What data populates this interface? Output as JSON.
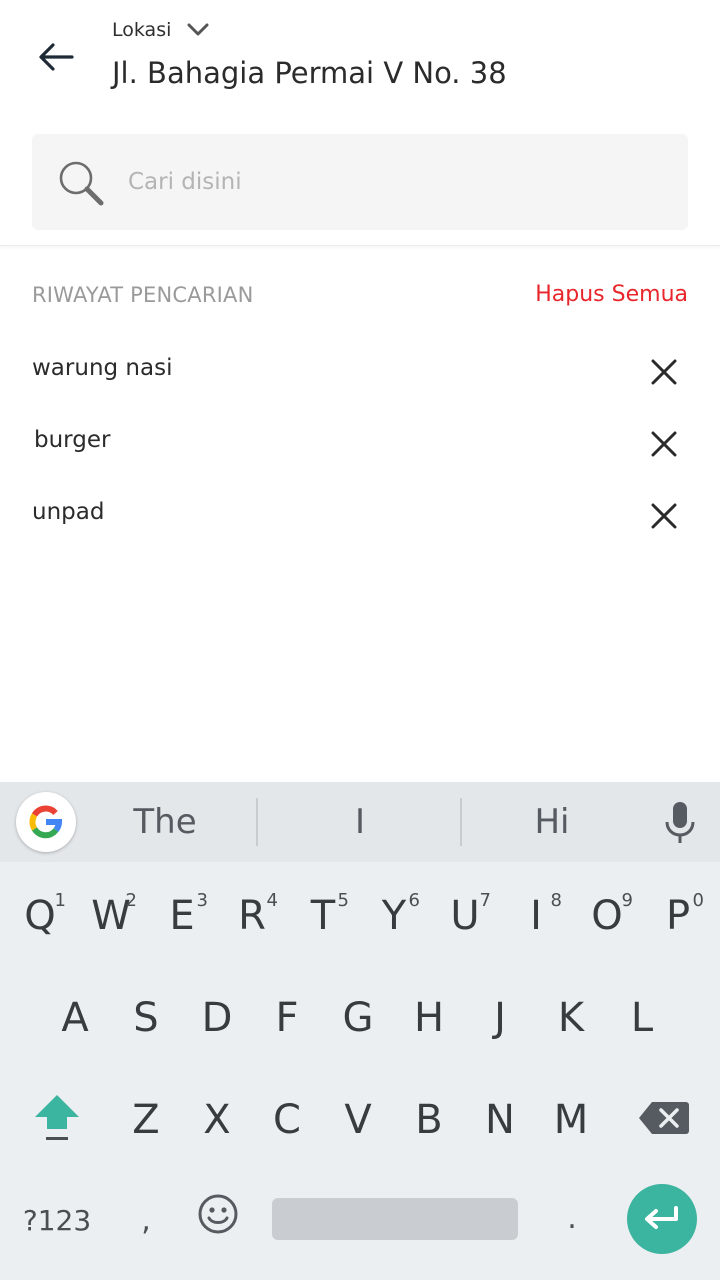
{
  "header": {
    "location_label": "Lokasi",
    "address": "Jl. Bahagia Permai V No. 38"
  },
  "search": {
    "placeholder": "Cari disini"
  },
  "history": {
    "title": "RIWAYAT PENCARIAN",
    "clear_all": "Hapus Semua",
    "items": [
      {
        "label": "warung nasi"
      },
      {
        "label": "burger"
      },
      {
        "label": "unpad"
      }
    ]
  },
  "keyboard": {
    "suggestions": [
      "The",
      "I",
      "Hi"
    ],
    "row1": [
      {
        "key": "Q",
        "hint": "1"
      },
      {
        "key": "W",
        "hint": "2"
      },
      {
        "key": "E",
        "hint": "3"
      },
      {
        "key": "R",
        "hint": "4"
      },
      {
        "key": "T",
        "hint": "5"
      },
      {
        "key": "Y",
        "hint": "6"
      },
      {
        "key": "U",
        "hint": "7"
      },
      {
        "key": "I",
        "hint": "8"
      },
      {
        "key": "O",
        "hint": "9"
      },
      {
        "key": "P",
        "hint": "0"
      }
    ],
    "row2": [
      "A",
      "S",
      "D",
      "F",
      "G",
      "H",
      "J",
      "K",
      "L"
    ],
    "row3": [
      "Z",
      "X",
      "C",
      "V",
      "B",
      "N",
      "M"
    ],
    "symbols_label": "?123",
    "comma": ",",
    "period": ".",
    "colors": {
      "enter": "#3bb4a0",
      "shift": "#3bb4a0",
      "clear_all": "#e8262b"
    }
  }
}
